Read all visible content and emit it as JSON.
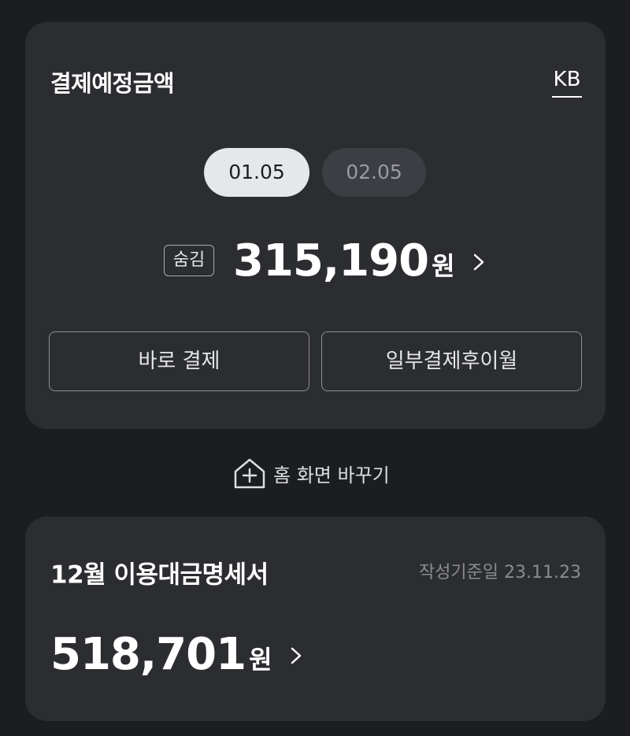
{
  "payment_card": {
    "title": "결제예정금액",
    "brand_tab": "KB",
    "dates": [
      {
        "label": "01.05",
        "selected": true
      },
      {
        "label": "02.05",
        "selected": false
      }
    ],
    "hide_label": "숨김",
    "amount": "315,190",
    "currency_unit": "원",
    "buttons": {
      "pay_now": "바로 결제",
      "partial_pay": "일부결제후이월"
    }
  },
  "home_change": {
    "label": "홈 화면 바꾸기",
    "icon": "home-plus-icon"
  },
  "statement_card": {
    "title": "12월 이용대금명세서",
    "issued_date": "작성기준일 23.11.23",
    "amount": "518,701",
    "currency_unit": "원"
  },
  "colors": {
    "background": "#1c1d20",
    "card": "#2c2d31",
    "active_pill": "#e4e8eb",
    "inactive_pill": "#3d3e43"
  }
}
